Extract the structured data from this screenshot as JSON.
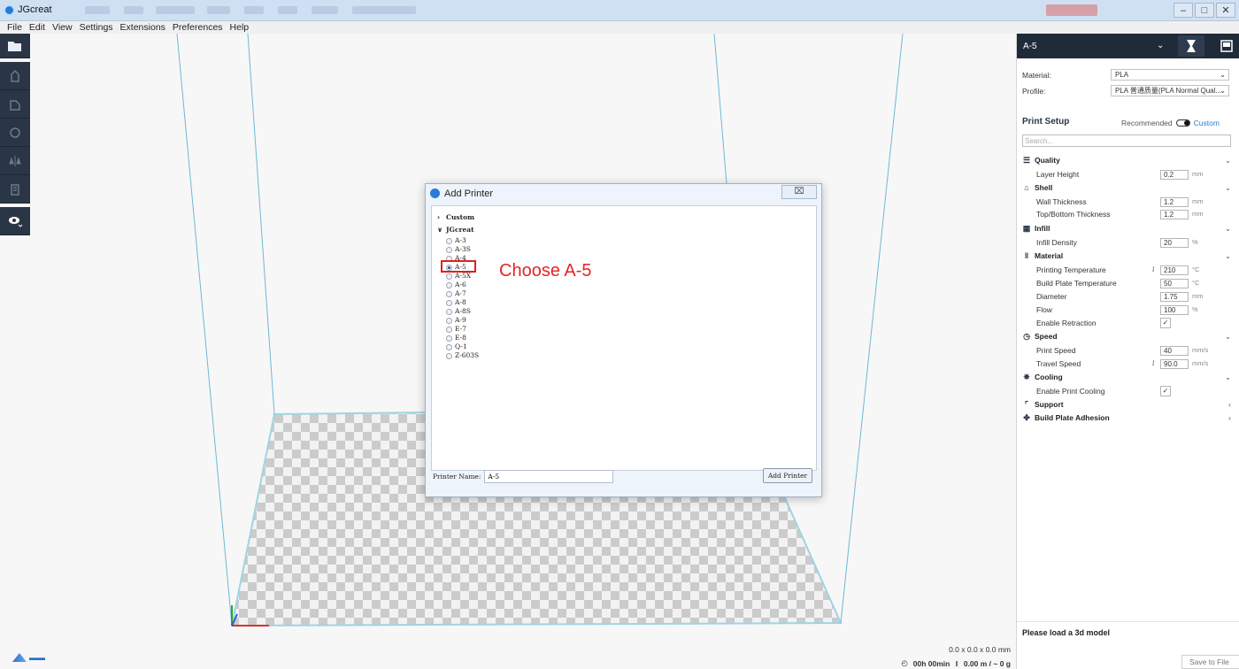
{
  "window": {
    "title": "JGcreat"
  },
  "menu": [
    "File",
    "Edit",
    "View",
    "Settings",
    "Extensions",
    "Preferences",
    "Help"
  ],
  "icons": {
    "open": "folder-open-icon",
    "view": "eye-icon"
  },
  "dialog": {
    "title": "Add Printer",
    "close_label": "⌧",
    "groups": [
      {
        "label": "Custom",
        "expanded": false
      },
      {
        "label": "JGcreat",
        "expanded": true
      }
    ],
    "printers": [
      "A-3",
      "A-3S",
      "A-4",
      "A-5",
      "A-5X",
      "A-6",
      "A-7",
      "A-8",
      "A-8S",
      "A-9",
      "E-7",
      "E-8",
      "Q-1",
      "Z-603S"
    ],
    "selected_printer": "A-5",
    "printer_name_label": "Printer Name:",
    "printer_name_value": "A-5",
    "add_button_label": "Add Printer"
  },
  "annotation": {
    "text": "Choose A-5",
    "color": "#e42424"
  },
  "bottom": {
    "dimensions": "0.0 x 0.0 x 0.0 mm",
    "time": "00h 00min",
    "material": "0.00 m / ~ 0 g"
  },
  "right_panel": {
    "printer": "A-5",
    "material_label": "Material:",
    "material_value": "PLA",
    "profile_label": "Profile:",
    "profile_value": "PLA 普通质量(PLA Normal Qual...",
    "print_setup_title": "Print Setup",
    "mode_recommended": "Recommended",
    "mode_custom": "Custom",
    "search_placeholder": "Search...",
    "categories": {
      "quality": "Quality",
      "shell": "Shell",
      "infill": "Infill",
      "material": "Material",
      "speed": "Speed",
      "cooling": "Cooling",
      "support": "Support",
      "adhesion": "Build Plate Adhesion"
    },
    "settings": {
      "layer_height": {
        "label": "Layer Height",
        "value": "0.2",
        "unit": "mm"
      },
      "wall_thickness": {
        "label": "Wall Thickness",
        "value": "1.2",
        "unit": "mm"
      },
      "top_bottom": {
        "label": "Top/Bottom Thickness",
        "value": "1.2",
        "unit": "mm"
      },
      "infill_density": {
        "label": "Infill Density",
        "value": "20",
        "unit": "%"
      },
      "print_temp": {
        "label": "Printing Temperature",
        "value": "210",
        "unit": "°C"
      },
      "bed_temp": {
        "label": "Build Plate Temperature",
        "value": "50",
        "unit": "°C"
      },
      "diameter": {
        "label": "Diameter",
        "value": "1.75",
        "unit": "mm"
      },
      "flow": {
        "label": "Flow",
        "value": "100",
        "unit": "%"
      },
      "retraction": {
        "label": "Enable Retraction",
        "checked": "✓"
      },
      "print_speed": {
        "label": "Print Speed",
        "value": "40",
        "unit": "mm/s"
      },
      "travel_speed": {
        "label": "Travel Speed",
        "value": "90.0",
        "unit": "mm/s"
      },
      "cooling": {
        "label": "Enable Print Cooling",
        "checked": "✓"
      }
    },
    "load_message": "Please load a 3d model",
    "save_button": "Save to File"
  }
}
